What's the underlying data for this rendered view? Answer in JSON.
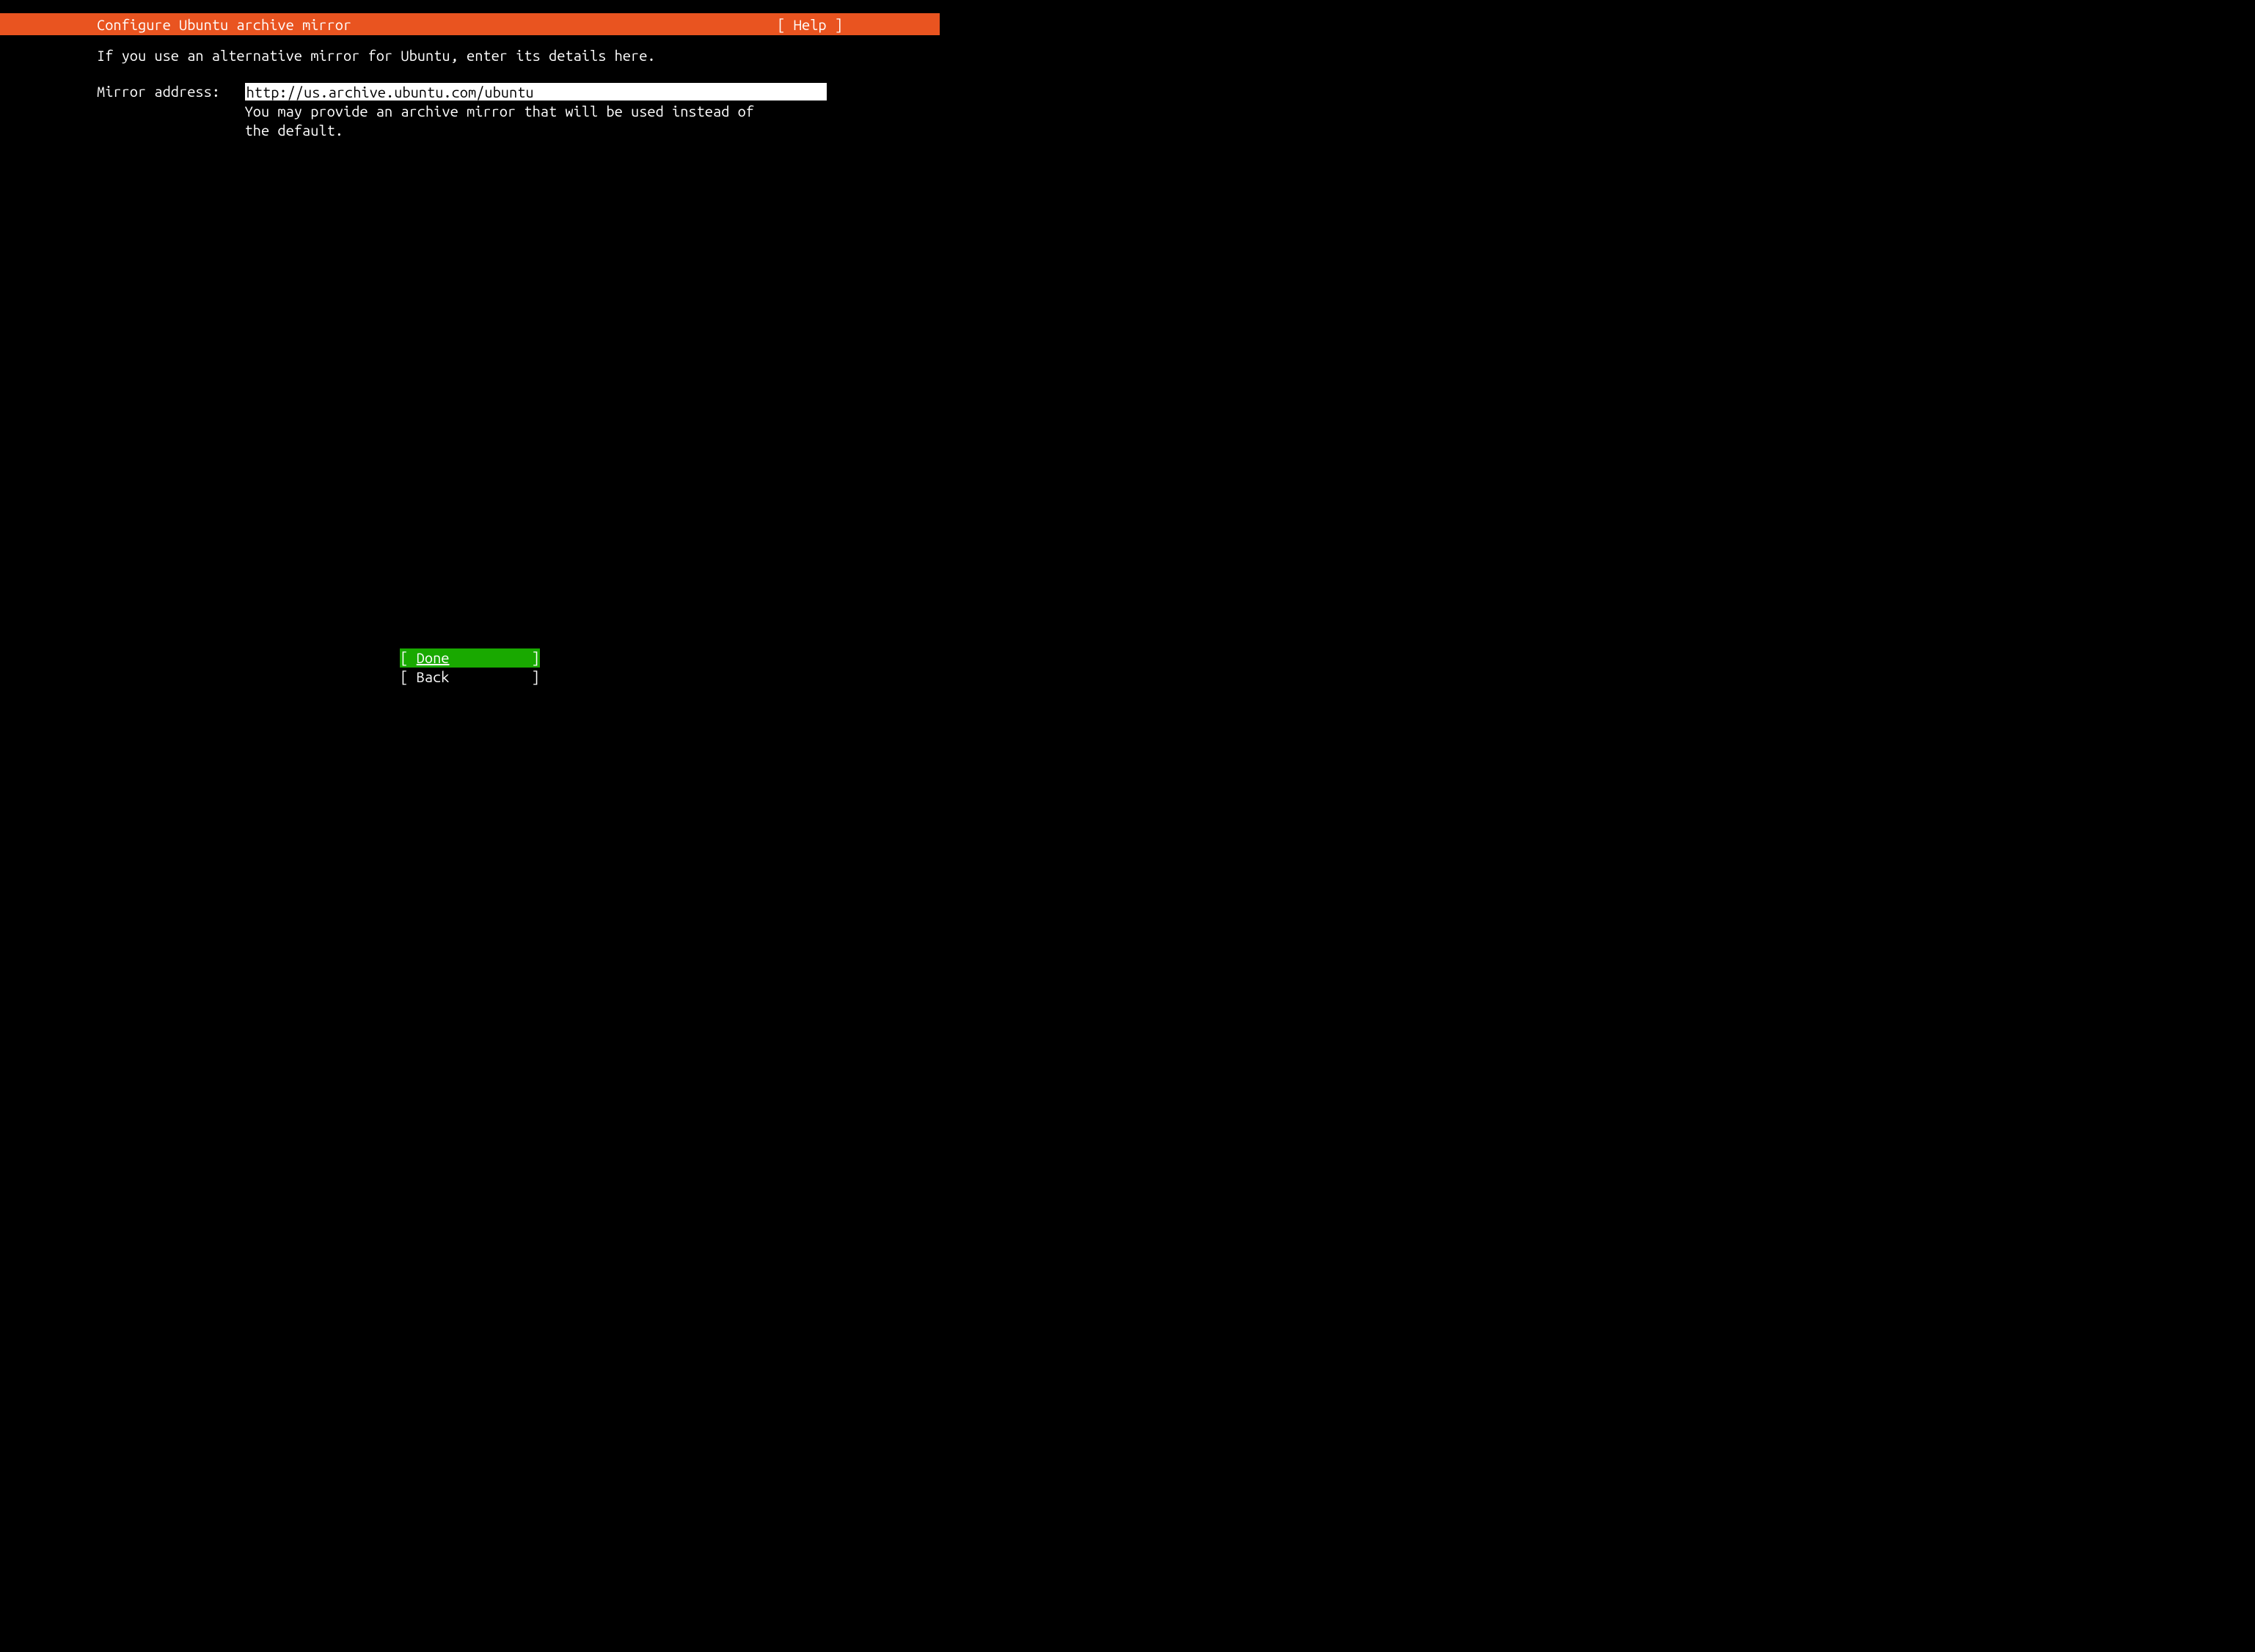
{
  "header": {
    "title": "Configure Ubuntu archive mirror",
    "help": "[ Help ]"
  },
  "intro": "If you use an alternative mirror for Ubuntu, enter its details here.",
  "form": {
    "label": "Mirror address:   ",
    "value": "http://us.archive.ubuntu.com/ubuntu",
    "hint": "You may provide an archive mirror that will be used instead of\nthe default."
  },
  "buttons": {
    "done_open": "[ ",
    "done_label": "Done",
    "done_close": "          ]",
    "back_open": "[ ",
    "back_label": "Back",
    "back_close": "          ]"
  }
}
